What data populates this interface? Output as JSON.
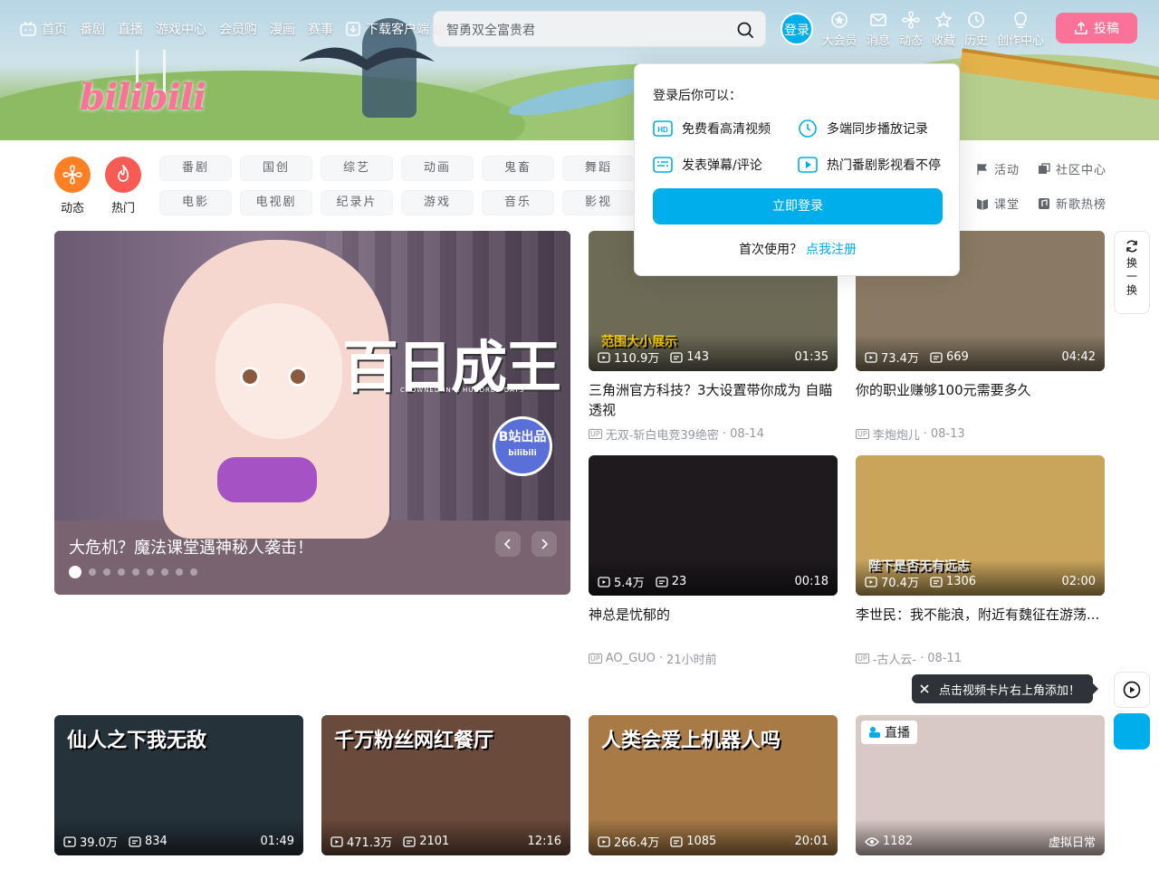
{
  "nav": {
    "items": [
      {
        "label": "首页",
        "icon": "tv-icon"
      },
      {
        "label": "番剧"
      },
      {
        "label": "直播"
      },
      {
        "label": "游戏中心"
      },
      {
        "label": "会员购"
      },
      {
        "label": "漫画"
      },
      {
        "label": "赛事"
      },
      {
        "label": "下载客户端",
        "icon": "download-icon",
        "badge": "新"
      }
    ],
    "search_placeholder": "智勇双全富贵君",
    "login": "登录",
    "right": [
      {
        "label": "大会员",
        "icon": "vip-icon"
      },
      {
        "label": "消息",
        "icon": "mail-icon"
      },
      {
        "label": "动态",
        "icon": "feed-icon"
      },
      {
        "label": "收藏",
        "icon": "star-icon"
      },
      {
        "label": "历史",
        "icon": "clock-icon"
      },
      {
        "label": "创作中心",
        "icon": "bulb-icon"
      }
    ],
    "upload": "投稿"
  },
  "banner": {
    "logo": "bilibili"
  },
  "channels": {
    "dynamic": "动态",
    "hot": "热门",
    "row1": [
      "番剧",
      "国创",
      "综艺",
      "动画",
      "鬼畜",
      "舞蹈"
    ],
    "row2": [
      "电影",
      "电视剧",
      "纪录片",
      "游戏",
      "音乐",
      "影视"
    ],
    "extras": [
      {
        "label": "活动",
        "icon": "flag-icon"
      },
      {
        "label": "社区中心",
        "icon": "community-icon"
      },
      {
        "label": "课堂",
        "icon": "class-icon"
      },
      {
        "label": "新歌热榜",
        "icon": "music-chart-icon"
      }
    ]
  },
  "hero": {
    "caption": "大危机？魔法课堂遇神秘人袭击！",
    "art_title": "百日成王",
    "art_sub": "CROWNED IN A HUNDRED DAYS",
    "badge": "B站出品",
    "badge_sub": "bilibili",
    "dots": 9,
    "active_dot": 0
  },
  "popover": {
    "title": "登录后你可以：",
    "perks": [
      {
        "label": "免费看高清视频",
        "icon": "hd-icon"
      },
      {
        "label": "多端同步播放记录",
        "icon": "clock-icon"
      },
      {
        "label": "发表弹幕/评论",
        "icon": "danmaku-icon"
      },
      {
        "label": "热门番剧影视看不停",
        "icon": "play-icon"
      }
    ],
    "button": "立即登录",
    "register_prefix": "首次使用？",
    "register_link": "点我注册"
  },
  "videos": [
    {
      "views": "110.9万",
      "danmaku": "143",
      "duration": "01:35",
      "title": "三角洲官方科技？3大设置带你成为 自瞄 透视",
      "up": "无双-斩白电竞39绝密",
      "date": "08-14",
      "art": "范围大小展示",
      "color": "#6d6a56"
    },
    {
      "views": "73.4万",
      "danmaku": "669",
      "duration": "04:42",
      "title": "你的职业赚够100元需要多久",
      "up": "李炮炮儿",
      "date": "08-13",
      "art": "",
      "color": "#8a7a64"
    },
    {
      "views": "5.4万",
      "danmaku": "23",
      "duration": "00:18",
      "title": "神总是忧郁的",
      "up": "AO_GUO",
      "date": "21小时前",
      "art": "",
      "color": "#1e1a1e"
    },
    {
      "views": "70.4万",
      "danmaku": "1306",
      "duration": "02:00",
      "title": "李世民：我不能浪，附近有魏征在游荡...",
      "up": "-古人云-",
      "date": "08-11",
      "art": "陛下是否无有远志",
      "color": "#c9a55c"
    },
    {
      "views": "39.0万",
      "danmaku": "834",
      "duration": "01:49",
      "title": "",
      "up": "",
      "date": "",
      "art": "仙人之下我无敌",
      "color": "#26323a"
    },
    {
      "views": "471.3万",
      "danmaku": "2101",
      "duration": "12:16",
      "title": "",
      "up": "",
      "date": "",
      "art": "千万粉丝网红餐厅",
      "color": "#6a4a3a"
    },
    {
      "views": "266.4万",
      "danmaku": "1085",
      "duration": "20:01",
      "title": "",
      "up": "",
      "date": "",
      "art": "人类会爱上机器人吗",
      "color": "#a87a46"
    },
    {
      "views": "1182",
      "danmaku": "",
      "duration": "虚拟日常",
      "title": "",
      "up": "",
      "date": "",
      "art": "",
      "color": "#d9c9c4",
      "live": "直播"
    }
  ],
  "side": {
    "refresh": "换一换",
    "tooltip": "点击视频卡片右上角添加！"
  }
}
